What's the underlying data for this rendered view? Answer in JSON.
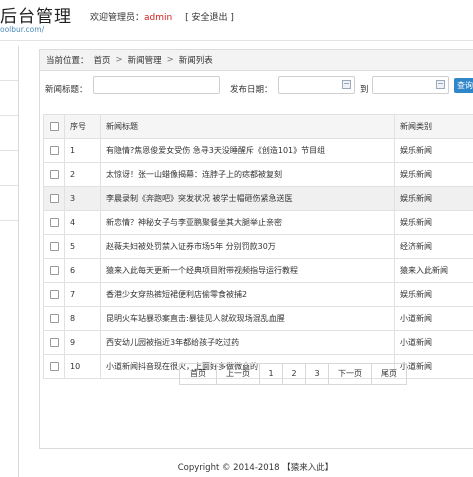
{
  "header": {
    "title": "后台管理",
    "subtitle": "oolbur.com/",
    "welcome_label": "欢迎管理员：",
    "username": "admin",
    "logout_label": "[ 安全退出 ]"
  },
  "breadcrumb": {
    "prefix": "当前位置：",
    "items": [
      "首页",
      "新闻管理",
      "新闻列表"
    ],
    "separator": ">"
  },
  "search": {
    "title_label": "新闻标题：",
    "date_label": "发布日期：",
    "to_label": "到",
    "button_label": "查询"
  },
  "table": {
    "headers": [
      "",
      "序号",
      "新闻标题",
      "新闻类别"
    ],
    "rows": [
      {
        "no": "1",
        "title": "有隐情?焦恩俊爱女受伤 急寻3天没睡醒斥《创造101》节目组",
        "category": "娱乐新闻"
      },
      {
        "no": "2",
        "title": "太惊讶！张一山蜡像揭幕：连脖子上的痣都被复刻",
        "category": "娱乐新闻"
      },
      {
        "no": "3",
        "title": "李晨录制《奔跑吧》突发状况 被学士帽砸伤紧急送医",
        "category": "娱乐新闻"
      },
      {
        "no": "4",
        "title": "新恋情？神秘女子与李亚鹏聚餐坐其大腿举止亲密",
        "category": "娱乐新闻"
      },
      {
        "no": "5",
        "title": "赵薇夫妇被处罚禁入证券市场5年 分别罚款30万",
        "category": "经济新闻"
      },
      {
        "no": "6",
        "title": "猿来入此每天更新一个经典项目附带视频指导运行教程",
        "category": "猿来入此新闻"
      },
      {
        "no": "7",
        "title": "香港少女穿热裤短裙便利店偷零食被捕2",
        "category": "娱乐新闻"
      },
      {
        "no": "8",
        "title": "昆明火车站暴恐案直击:暴徒见人就砍现场混乱血腥",
        "category": "小道新闻"
      },
      {
        "no": "9",
        "title": "西安幼儿园被指近3年都给孩子吃过药",
        "category": "小道新闻"
      },
      {
        "no": "10",
        "title": "小道新闻抖音现在很火，上面好多做微商的",
        "category": "小道新闻"
      }
    ]
  },
  "pagination": {
    "first": "首页",
    "prev": "上一页",
    "pages": [
      "1",
      "2",
      "3"
    ],
    "next": "下一页",
    "last": "尾页"
  },
  "footer": {
    "copyright": "Copyright © 2014-2018 【猿来入此】"
  }
}
